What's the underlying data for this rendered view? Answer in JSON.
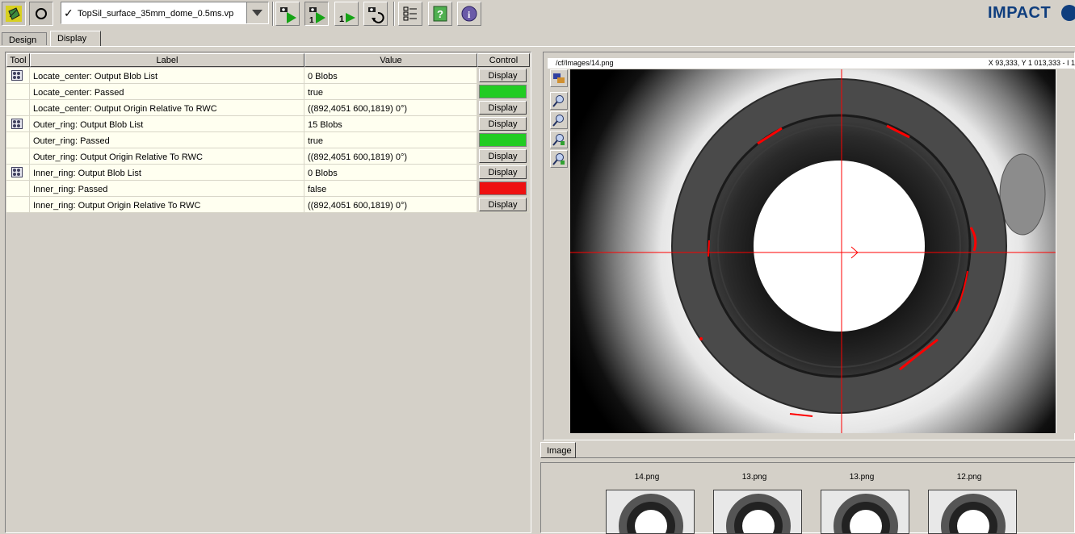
{
  "toolbar": {
    "program_file": "TopSil_surface_35mm_dome_0.5ms.vp",
    "logo_text": "IMPACT",
    "buttons": [
      {
        "icon": "design-mode-icon"
      },
      {
        "icon": "stop-icon"
      },
      {
        "icon": "run-continuous-icon"
      },
      {
        "icon": "run-once-with-camera-icon"
      },
      {
        "icon": "run-single-step-icon"
      },
      {
        "icon": "run-reload-icon"
      },
      {
        "icon": "checklist-icon"
      },
      {
        "icon": "help-icon"
      },
      {
        "icon": "info-icon"
      }
    ]
  },
  "tabs": {
    "design": "Design",
    "display": "Display",
    "active": "Display"
  },
  "table": {
    "headers": {
      "tool": "Tool",
      "label": "Label",
      "value": "Value",
      "control": "Control"
    },
    "rows": [
      {
        "tool_icon": true,
        "label": "Locate_center: Output Blob List",
        "value": "0 Blobs",
        "control": "Display"
      },
      {
        "tool_icon": false,
        "label": "Locate_center: Passed",
        "value": "true",
        "control_status": "pass"
      },
      {
        "tool_icon": false,
        "label": "Locate_center: Output Origin Relative To RWC",
        "value": "((892,4051 600,1819) 0°)",
        "control": "Display"
      },
      {
        "tool_icon": true,
        "label": "Outer_ring: Output Blob List",
        "value": "15 Blobs",
        "control": "Display"
      },
      {
        "tool_icon": false,
        "label": "Outer_ring: Passed",
        "value": "true",
        "control_status": "pass"
      },
      {
        "tool_icon": false,
        "label": "Outer_ring: Output Origin Relative To RWC",
        "value": "((892,4051 600,1819) 0°)",
        "control": "Display"
      },
      {
        "tool_icon": true,
        "label": "Inner_ring: Output Blob List",
        "value": "0 Blobs",
        "control": "Display"
      },
      {
        "tool_icon": false,
        "label": "Inner_ring: Passed",
        "value": "false",
        "control_status": "fail"
      },
      {
        "tool_icon": false,
        "label": "Inner_ring: Output Origin Relative To RWC",
        "value": "((892,4051 600,1819) 0°)",
        "control": "Display"
      }
    ]
  },
  "status_colors": {
    "pass": "#22cc22",
    "fail": "#ee1111"
  },
  "image_viewer": {
    "path": "/cf/Images/14.png",
    "coords": "X 93,333,  Y 1 013,333  -  I 1",
    "tab": "Image",
    "zoom_tools": [
      "image-source-icon",
      "zoom-in-icon",
      "zoom-out-icon",
      "zoom-fit-icon",
      "zoom-reset-icon"
    ]
  },
  "thumbnails": [
    {
      "label": "14.png"
    },
    {
      "label": "13.png"
    },
    {
      "label": "13.png"
    },
    {
      "label": "12.png"
    }
  ],
  "colors": {
    "overlay": "#ff0000",
    "logo": "#0f3e7e"
  }
}
